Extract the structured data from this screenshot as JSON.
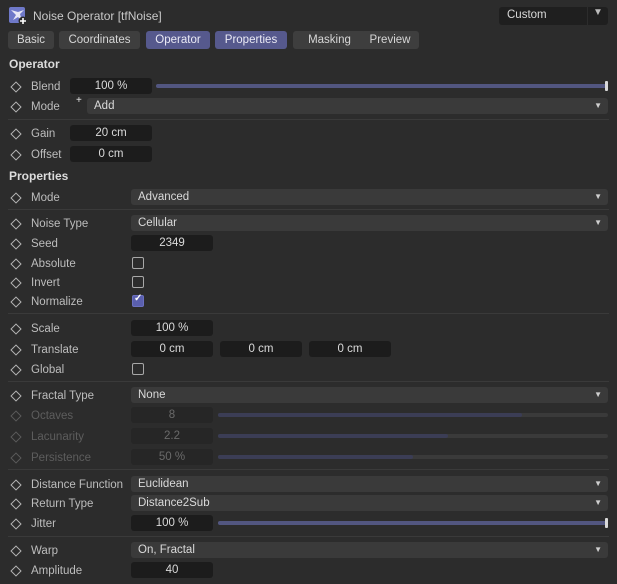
{
  "window": {
    "title": "Noise Operator [tfNoise]",
    "preset": "Custom"
  },
  "tabs": [
    {
      "label": "Basic",
      "active": false
    },
    {
      "label": "Coordinates",
      "active": false
    },
    {
      "label": "Operator",
      "active": true
    },
    {
      "label": "Properties",
      "active": true
    },
    {
      "label": "Masking",
      "active": false
    },
    {
      "label": "Preview",
      "active": false
    }
  ],
  "operator": {
    "heading": "Operator",
    "blend": {
      "label": "Blend",
      "value": "100 %",
      "level": 1.0
    },
    "mode": {
      "label": "Mode",
      "value": "Add"
    },
    "gain": {
      "label": "Gain",
      "value": "20 cm"
    },
    "offset": {
      "label": "Offset",
      "value": "0 cm"
    }
  },
  "properties": {
    "heading": "Properties",
    "mode": {
      "label": "Mode",
      "value": "Advanced"
    },
    "noise_type": {
      "label": "Noise Type",
      "value": "Cellular"
    },
    "seed": {
      "label": "Seed",
      "value": "2349"
    },
    "absolute": {
      "label": "Absolute",
      "checked": false
    },
    "invert": {
      "label": "Invert",
      "checked": false
    },
    "normalize": {
      "label": "Normalize",
      "checked": true
    },
    "scale": {
      "label": "Scale",
      "value": "100 %"
    },
    "translate": {
      "label": "Translate",
      "x": "0 cm",
      "y": "0 cm",
      "z": "0 cm"
    },
    "global": {
      "label": "Global",
      "checked": false
    },
    "fractal_type": {
      "label": "Fractal Type",
      "value": "None"
    },
    "octaves": {
      "label": "Octaves",
      "value": "8",
      "level": 0.78
    },
    "lacunarity": {
      "label": "Lacunarity",
      "value": "2.2",
      "level": 0.59
    },
    "persistence": {
      "label": "Persistence",
      "value": "50 %",
      "level": 0.5
    },
    "distance_function": {
      "label": "Distance Function",
      "value": "Euclidean"
    },
    "return_type": {
      "label": "Return Type",
      "value": "Distance2Sub"
    },
    "jitter": {
      "label": "Jitter",
      "value": "100 %",
      "level": 1.0
    },
    "warp": {
      "label": "Warp",
      "value": "On, Fractal"
    },
    "amplitude": {
      "label": "Amplitude",
      "value": "40"
    }
  },
  "colors": {
    "accent": "#56598d",
    "background": "#2c2c2c",
    "field": "#1c1c1c"
  },
  "icons": {
    "app": "noise-operator-icon",
    "keyframe": "keyframe-diamond-icon",
    "dropdown": "chevron-down-icon"
  }
}
